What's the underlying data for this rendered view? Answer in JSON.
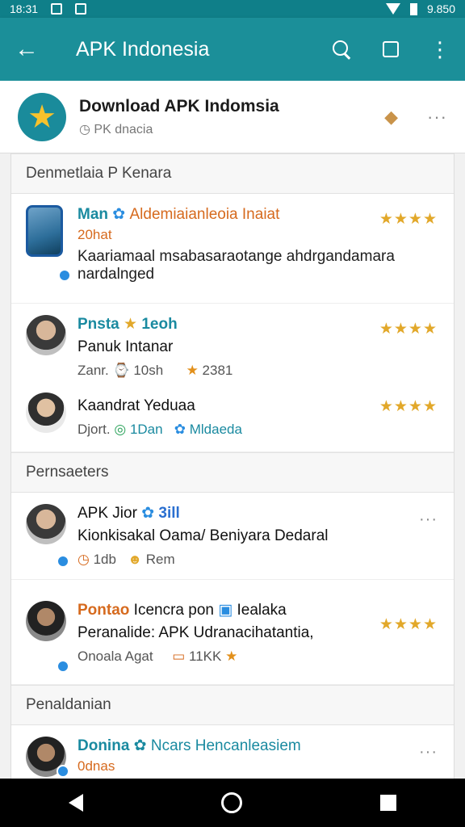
{
  "status_bar": {
    "left_text": "18:31",
    "right_text": "9.850"
  },
  "app_bar": {
    "title": "APK Indonesia"
  },
  "header": {
    "title": "Download APK Indomsia",
    "subtitle": "PK dnacia"
  },
  "sections": [
    {
      "label": "Denmetlaia P Kenara"
    },
    {
      "label": "Pernsaeters"
    },
    {
      "label": "Penaldanian"
    }
  ],
  "items": [
    {
      "title_main": "Man",
      "title_accent": "Aldemiaianleoia Inaiat",
      "sub": "20hat",
      "body": "Kaariamaal msabasaraotange ahdrgandamara nardalnged",
      "rating": "★★★★"
    },
    {
      "title_main": "Pnsta",
      "title_extra": "1eoh",
      "name": "Panuk Intanar",
      "meta1": "Zanr. ⌚ 10sh",
      "meta2": "2381",
      "rating": "★★★★"
    },
    {
      "name": "Kaandrat Yeduaa",
      "meta1": "Djort.",
      "meta2": "1Dan",
      "meta3": "Mldaeda",
      "rating": "★★★★"
    },
    {
      "title_main": "APK Jior",
      "title_extra": "3ill",
      "name": "Kionkisakal Oama/ Beniyara Dedaral",
      "meta1": "1db",
      "meta2": "Rem",
      "more": "···"
    },
    {
      "title_main": "Pontao",
      "title_accent": "Icencra pon",
      "title_tail": "Iealaka",
      "name": "Peranalide: APK Udranacihatantia,",
      "meta1": "Onoala Agat",
      "meta2": "11KK",
      "rating": "★★★★"
    },
    {
      "title_main": "Donina",
      "title_accent": "Ncars Hencanleasiem",
      "sub": "0dnas",
      "more": "···"
    }
  ],
  "colors": {
    "appbar": "#1b8f99",
    "statusbar": "#0f7f89",
    "accent_teal": "#1a8aa0",
    "accent_orange": "#d66a1e",
    "star": "#e2a82a"
  },
  "icons": [
    "back-arrow-icon",
    "search-icon",
    "square-icon",
    "more-vert-icon",
    "star-icon",
    "pin-icon",
    "clock-icon",
    "verified-badge-icon",
    "nav-back-icon",
    "nav-home-icon",
    "nav-recent-icon"
  ]
}
